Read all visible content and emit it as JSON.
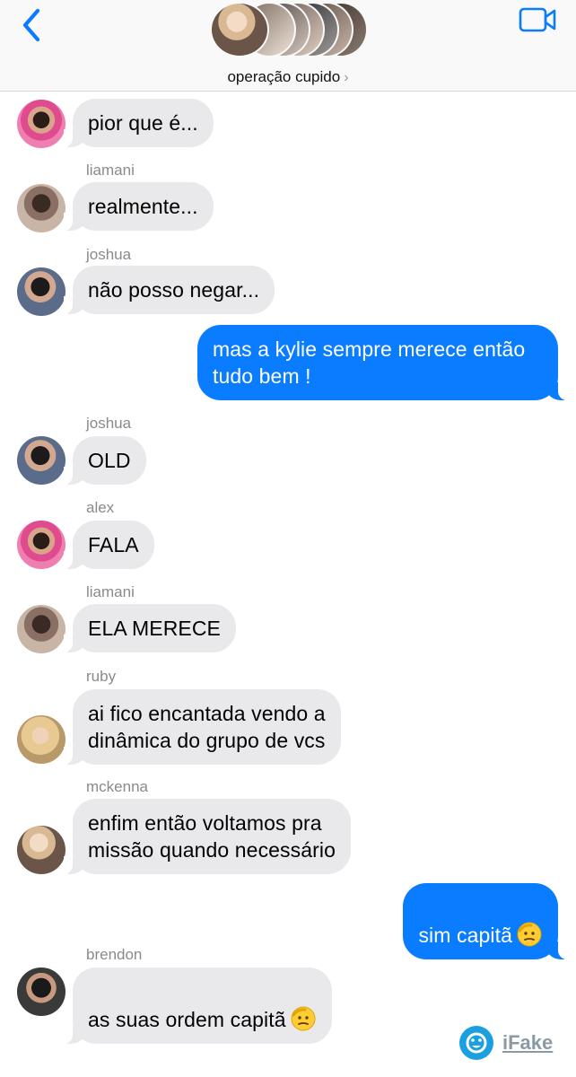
{
  "header": {
    "group_name": "operação cupido",
    "chevron": "›",
    "back_icon": "chevron-left-icon",
    "video_icon": "video-camera-icon",
    "accent_color": "#0a7cff"
  },
  "messages": [
    {
      "sender": "",
      "text": "pior que é...",
      "direction": "incoming"
    },
    {
      "sender": "liamani",
      "text": "realmente...",
      "direction": "incoming"
    },
    {
      "sender": "joshua",
      "text": "não posso negar...",
      "direction": "incoming"
    },
    {
      "sender": "",
      "text": "mas a kylie sempre merece então\ntudo bem !",
      "direction": "outgoing"
    },
    {
      "sender": "joshua",
      "text": "OLD",
      "direction": "incoming"
    },
    {
      "sender": "alex",
      "text": "FALA",
      "direction": "incoming"
    },
    {
      "sender": "liamani",
      "text": "ELA MERECE",
      "direction": "incoming"
    },
    {
      "sender": "ruby",
      "text": "ai fico encantada vendo a\ndinâmica do grupo de vcs",
      "direction": "incoming"
    },
    {
      "sender": "mckenna",
      "text": "enfim então voltamos pra\nmissão quando necessário",
      "direction": "incoming"
    },
    {
      "sender": "",
      "text": "sim capitã",
      "emoji": "saluting-face",
      "direction": "outgoing"
    },
    {
      "sender": "brendon",
      "text": "as suas ordem capitã",
      "emoji": "saluting-face",
      "direction": "incoming"
    }
  ],
  "watermark": {
    "label": "iFake",
    "icon": "smiley-icon"
  },
  "colors": {
    "incoming_bubble": "#e9e9eb",
    "outgoing_bubble": "#0a7cff",
    "sender_name": "#8a8a8e"
  }
}
